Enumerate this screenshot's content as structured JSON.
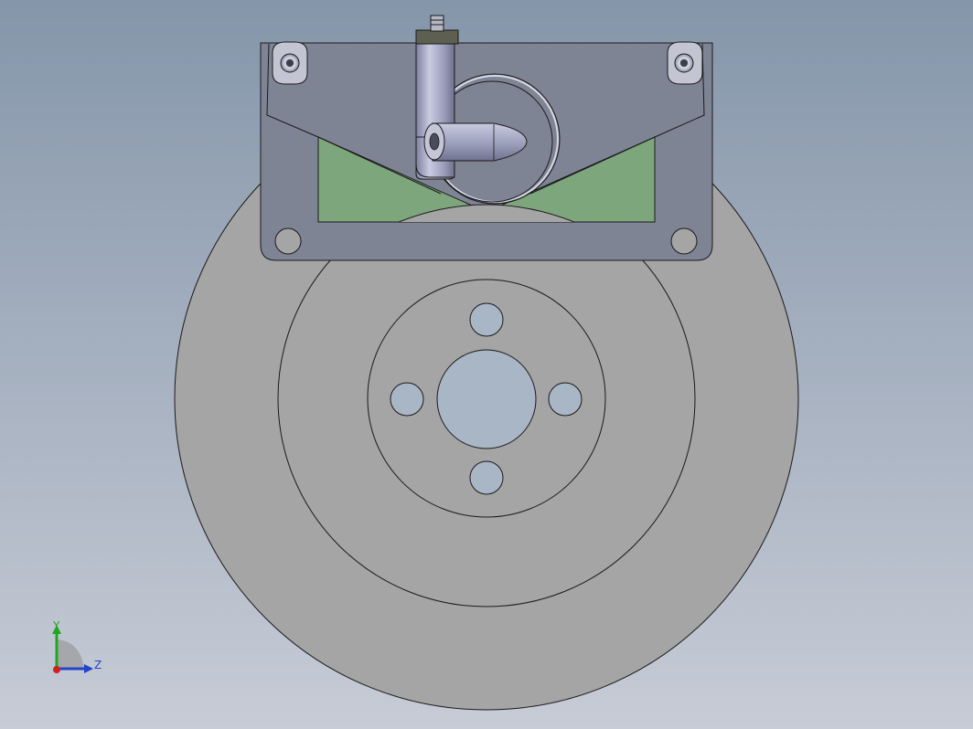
{
  "viewport": {
    "background_top": "#8596aa",
    "background_bottom": "#c7ccd6"
  },
  "model": {
    "rotor_color": "#a5a5a5",
    "caliper_color": "#7e8494",
    "pad_color": "#7ea67d",
    "hole_color": "#a9b6c6",
    "outline_color": "#1a1a1a"
  },
  "triad": {
    "y_label": "Y",
    "z_label": "Z",
    "y_color": "#1fa81f",
    "z_color": "#2244cc",
    "origin_color": "#d02020"
  }
}
